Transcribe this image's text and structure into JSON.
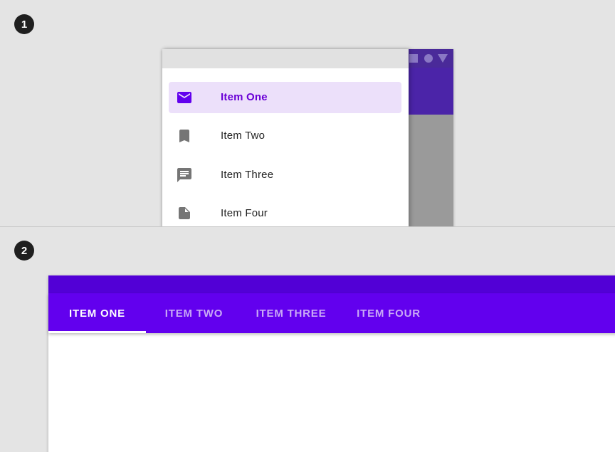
{
  "panel1": {
    "step": "1",
    "drawer": {
      "items": [
        {
          "label": "Item One",
          "icon": "mail-icon",
          "active": true
        },
        {
          "label": "Item Two",
          "icon": "bookmark-icon",
          "active": false
        },
        {
          "label": "Item Three",
          "icon": "chat-icon",
          "active": false
        },
        {
          "label": "Item Four",
          "icon": "note-icon",
          "active": false
        }
      ]
    }
  },
  "panel2": {
    "step": "2",
    "tabs": [
      {
        "label": "ITEM ONE",
        "active": true
      },
      {
        "label": "ITEM TWO",
        "active": false
      },
      {
        "label": "ITEM THREE",
        "active": false
      },
      {
        "label": "ITEM FOUR",
        "active": false
      }
    ]
  },
  "colors": {
    "primary": "#6200ee",
    "primary_dark": "#5200d6",
    "active_item_bg": "#ece0fa",
    "active_item_text": "#6a00d6",
    "inactive_icon": "#757575",
    "inactive_tab_text": "#c9a9f6"
  }
}
